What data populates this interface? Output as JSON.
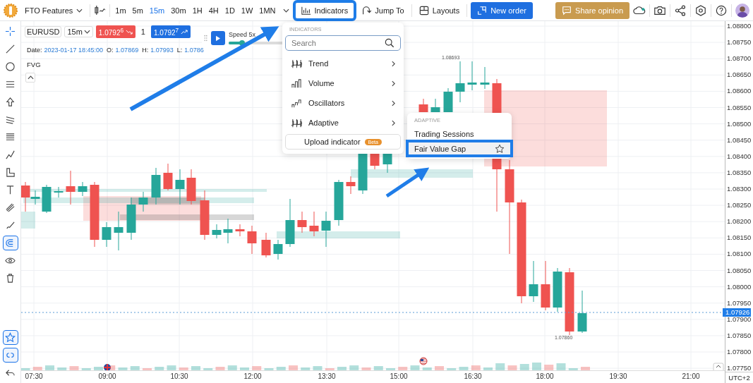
{
  "top_bar": {
    "app_name": "FTO Features",
    "timeframes": [
      {
        "label": "1m",
        "selected": false
      },
      {
        "label": "5m",
        "selected": false
      },
      {
        "label": "15m",
        "selected": true
      },
      {
        "label": "30m",
        "selected": false
      },
      {
        "label": "1H",
        "selected": false
      },
      {
        "label": "4H",
        "selected": false
      },
      {
        "label": "1D",
        "selected": false
      },
      {
        "label": "1W",
        "selected": false
      },
      {
        "label": "1MN",
        "selected": false
      }
    ],
    "indicators_button": {
      "label": "Indicators",
      "callout": true
    },
    "jump_to_button": "Jump To",
    "layouts_button": "Layouts",
    "new_order_button": "New order",
    "share_opinion_button": "Share opinion"
  },
  "left_toolbar": {
    "tools": [
      {
        "on": false
      },
      {
        "on": false
      },
      {
        "on": false
      },
      {
        "on": false
      },
      {
        "on": false
      },
      {
        "on": false
      },
      {
        "on": false
      },
      {
        "on": false
      },
      {
        "on": false
      },
      {
        "on": false
      },
      {
        "on": false
      },
      {
        "on": false
      },
      {
        "on": true
      },
      {
        "on": false
      },
      {
        "on": false
      }
    ],
    "bottom_tools": [
      {
        "on": true
      },
      {
        "on": true
      },
      {
        "on": false
      }
    ]
  },
  "chart": {
    "symbol": "EURUSD",
    "interval": "15m",
    "sell_price": "1.0792$^{6}$",
    "quantity": "1",
    "buy_price": "1.0792$^{7}$",
    "replay": {
      "speed_label": "Speed 5x",
      "level": 0.25
    },
    "ohlc": [
      {
        "label": "Date:",
        "value": "2023-01-17 18:45:00"
      },
      {
        "label": "O:",
        "value": "1.07869"
      },
      {
        "label": "H:",
        "value": "1.07993"
      },
      {
        "label": "L:",
        "value": "1.0786"
      }
    ],
    "indicator_label": "FVG",
    "high_marker": "1.08693",
    "low_marker": "1.07860",
    "price_axis": [
      "1.08800",
      "1.08750",
      "1.08700",
      "1.08650",
      "1.08600",
      "1.08550",
      "1.08500",
      "1.08450",
      "1.08400",
      "1.08350",
      "1.08300",
      "1.08250",
      "1.08200",
      "1.08150",
      "1.08100",
      "1.08050",
      "1.08000",
      "1.07950",
      "1.07900",
      "1.07850",
      "1.07800",
      "1.07750"
    ],
    "current_price": "1.07926",
    "time_axis": [
      "07:30",
      "09:00",
      "10:30",
      "12:00",
      "13:30",
      "15:00",
      "16:30",
      "18:00",
      "19:30",
      "21:00"
    ],
    "timezone": "UTC+2"
  },
  "indicators_menu": {
    "heading": "INDICATORS",
    "search": {
      "placeholder": "Search"
    },
    "categories": [
      {
        "label": "Trend"
      },
      {
        "label": "Volume"
      },
      {
        "label": "Oscillators"
      },
      {
        "label": "Adaptive"
      }
    ],
    "upload_button": "Upload indicator",
    "upload_badge": "Beta"
  },
  "submenu": {
    "heading": "ADAPTIVE",
    "items": [
      {
        "label": "Trading Sessions",
        "selected": false,
        "callout": false
      },
      {
        "label": "Fair Value Gap",
        "selected": true,
        "callout": true
      }
    ]
  }
}
